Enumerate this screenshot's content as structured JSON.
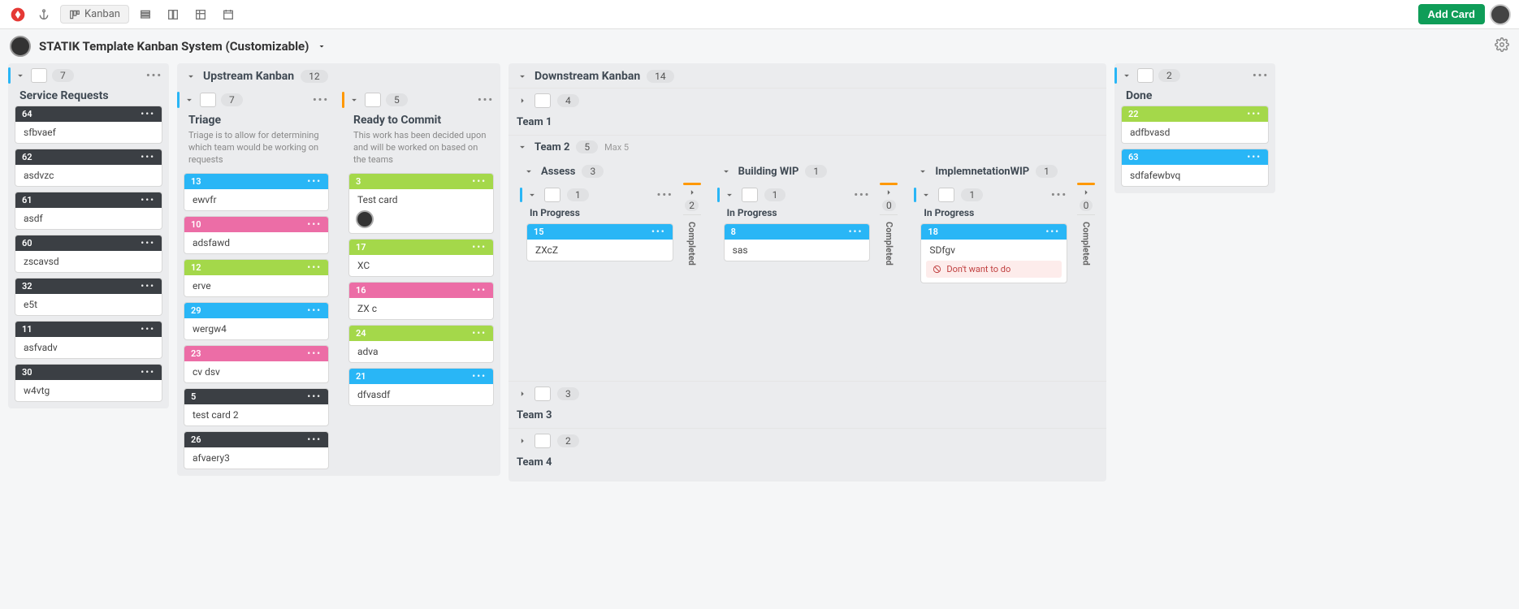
{
  "toolbar": {
    "kanban_tab": "Kanban",
    "add_card": "Add Card"
  },
  "board": {
    "title": "STATIK Template Kanban System (Customizable)"
  },
  "service": {
    "count": "7",
    "title": "Service Requests",
    "cards": [
      {
        "id": "64",
        "title": "sfbvaef"
      },
      {
        "id": "62",
        "title": "asdvzc"
      },
      {
        "id": "61",
        "title": "asdf"
      },
      {
        "id": "60",
        "title": "zscavsd"
      },
      {
        "id": "32",
        "title": "e5t"
      },
      {
        "id": "11",
        "title": "asfvadv"
      },
      {
        "id": "30",
        "title": "w4vtg"
      }
    ]
  },
  "upstream": {
    "title": "Upstream Kanban",
    "count": "12",
    "triage": {
      "count": "7",
      "title": "Triage",
      "desc": "Triage is to allow for determining which team would be working on requests",
      "cards": [
        {
          "id": "13",
          "title": "ewvfr",
          "color": "blue"
        },
        {
          "id": "10",
          "title": "adsfawd",
          "color": "pink"
        },
        {
          "id": "12",
          "title": "erve",
          "color": "green"
        },
        {
          "id": "29",
          "title": "wergw4",
          "color": "blue"
        },
        {
          "id": "23",
          "title": "cv dsv",
          "color": "pink"
        },
        {
          "id": "5",
          "title": "test card 2",
          "color": "dark"
        },
        {
          "id": "26",
          "title": "afvaery3",
          "color": "dark"
        }
      ]
    },
    "ready": {
      "count": "5",
      "title": "Ready to Commit",
      "desc": "This work has been decided upon and will be worked on based on the teams",
      "cards": [
        {
          "id": "3",
          "title": "Test card",
          "color": "green",
          "avatar": true
        },
        {
          "id": "17",
          "title": "XC",
          "color": "green"
        },
        {
          "id": "16",
          "title": "ZX c",
          "color": "pink"
        },
        {
          "id": "24",
          "title": "adva",
          "color": "green"
        },
        {
          "id": "21",
          "title": "dfvasdf",
          "color": "blue"
        }
      ]
    }
  },
  "downstream": {
    "title": "Downstream Kanban",
    "count": "14",
    "team1": {
      "count": "4",
      "title": "Team 1"
    },
    "team2": {
      "count": "5",
      "max": "Max 5",
      "title": "Team 2",
      "sections": [
        {
          "title": "Assess",
          "count": "3",
          "inprog_count": "1",
          "completed_count": "2",
          "inprog_title": "In Progress",
          "completed_title": "Completed",
          "cards": [
            {
              "id": "15",
              "title": "ZXcZ",
              "color": "blue"
            }
          ]
        },
        {
          "title": "Building WIP",
          "count": "1",
          "inprog_count": "1",
          "completed_count": "0",
          "inprog_title": "In Progress",
          "completed_title": "Completed",
          "cards": [
            {
              "id": "8",
              "title": "sas",
              "color": "blue"
            }
          ]
        },
        {
          "title": "ImplemnetationWIP",
          "count": "1",
          "inprog_count": "1",
          "completed_count": "0",
          "inprog_title": "In Progress",
          "completed_title": "Completed",
          "cards": [
            {
              "id": "18",
              "title": "SDfgv",
              "color": "blue",
              "block": "Don't want to do"
            }
          ]
        }
      ]
    },
    "team3": {
      "count": "3",
      "title": "Team 3"
    },
    "team4": {
      "count": "2",
      "title": "Team 4"
    }
  },
  "done": {
    "count": "2",
    "title": "Done",
    "cards": [
      {
        "id": "22",
        "title": "adfbvasd",
        "color": "green"
      },
      {
        "id": "63",
        "title": "sdfafewbvq",
        "color": "blue"
      }
    ]
  }
}
